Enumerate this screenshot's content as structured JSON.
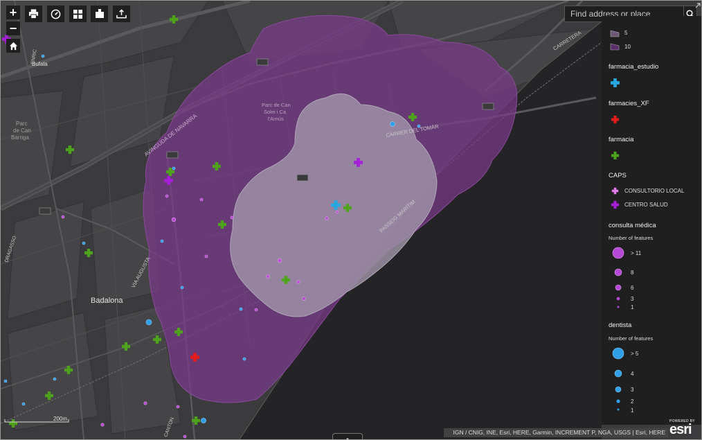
{
  "search": {
    "placeholder": "Find address or place"
  },
  "toolbar": {
    "zoom_in_label": "+",
    "zoom_out_label": "−",
    "tools": [
      "print-icon",
      "measure-icon",
      "basemap-gallery-icon",
      "bookmark-icon",
      "share-icon"
    ]
  },
  "map_labels": {
    "bufala": "Bufala",
    "parc_can_banya": [
      "Parc",
      "de Can",
      "Barriga"
    ],
    "parc_can_soleil": [
      "Parc de Can",
      "Solei i Ca",
      "l'Arnús"
    ],
    "badalona": "Badalona",
    "av_navarra": "AVINGUDA DE NAVARRA",
    "carrer_tomar": "CARRER DEL TOMÀR",
    "passeig_maritim": "PASSEIG MARÍTIM",
    "carretera": "CARRETERA",
    "via_augusta": "VIA AUGUSTA",
    "dragasso": "DRAGASSO",
    "enric": "ENRIC",
    "canton": "CANTON",
    "scale": "200m"
  },
  "legend": {
    "drive_time": [
      {
        "label": "5",
        "color": "#6e5a76"
      },
      {
        "label": "10",
        "color": "#5a2f6a"
      }
    ],
    "farmacia_estudio": {
      "title": "farmacia_estudio",
      "color": "#29a8e0"
    },
    "farmacies_xf": {
      "title": "farmacies_XF",
      "color": "#e51c1c"
    },
    "farmacia": {
      "title": "farmacia",
      "color": "#4fa31c"
    },
    "caps": {
      "title": "CAPS",
      "items": [
        {
          "label": "CONSULTORIO LOCAL",
          "color": "#e27ae8"
        },
        {
          "label": "CENTRO SALUD",
          "color": "#a51fd6"
        }
      ]
    },
    "consulta_medica": {
      "title": "consulta médica",
      "subtitle": "Number of features",
      "color": "#b548d6",
      "items": [
        {
          "label": "> 11"
        },
        {
          "label": "8"
        },
        {
          "label": "6"
        },
        {
          "label": "3"
        },
        {
          "label": "1"
        }
      ]
    },
    "dentista": {
      "title": "dentista",
      "subtitle": "Number of features",
      "color": "#2f9fe8",
      "items": [
        {
          "label": "> 5"
        },
        {
          "label": "4"
        },
        {
          "label": "3"
        },
        {
          "label": "2"
        },
        {
          "label": "1"
        }
      ]
    }
  },
  "attribution": "IGN / CNIG, INE, Esri, HERE, Garmin, INCREMENT P, NGA, USGS | Esri, HERE",
  "esri": {
    "powered_by": "POWERED BY",
    "logo": "esri"
  },
  "colors": {
    "farmacia": "#4fa31c",
    "farmacia_estudio": "#29a8e0",
    "farmacies_xf": "#e51c1c",
    "consultorio": "#e27ae8",
    "centro_salud": "#a51fd6",
    "consulta": "#b548d6",
    "dentista": "#2f9fe8"
  }
}
